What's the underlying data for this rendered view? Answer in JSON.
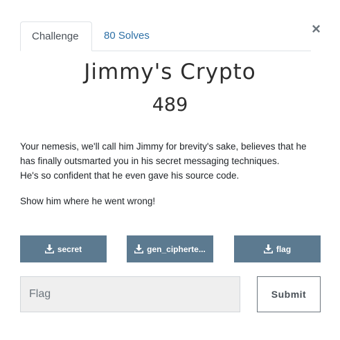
{
  "tabs": {
    "challenge": "Challenge",
    "solves": "80 Solves"
  },
  "close_glyph": "×",
  "challenge": {
    "name": "Jimmy's Crypto",
    "value": "489",
    "description": {
      "line1": "Your nemesis, we'll call him Jimmy for brevity's sake, believes that he",
      "line2": "has finally outsmarted you in his secret messaging techniques.",
      "line3": "He's so confident that he even gave his source code.",
      "line4": "Show him where he went wrong!"
    }
  },
  "files": [
    {
      "label": "secret",
      "icon": "download-icon"
    },
    {
      "label": "gen_ciphertе...",
      "icon": "download-icon"
    },
    {
      "label": "flag",
      "icon": "download-icon"
    }
  ],
  "flag_input": {
    "placeholder": "Flag",
    "value": ""
  },
  "submit_label": "Submit",
  "colors": {
    "file_button_bg": "#5c7a90",
    "tab_link": "#2c6fa5",
    "input_bg": "#efefef"
  }
}
